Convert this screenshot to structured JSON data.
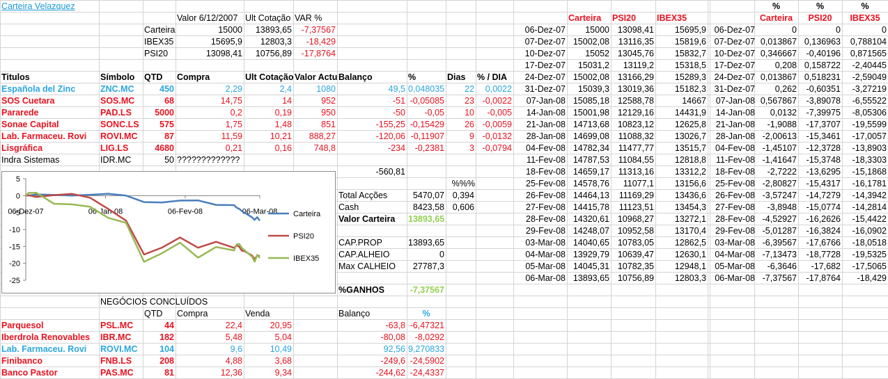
{
  "colors": {
    "red": "#e8121f",
    "blue": "#2aa6de",
    "green": "#92d050",
    "gridline": "#d4d4d4"
  },
  "title": "Carteira Velazquez",
  "summary": {
    "headers": {
      "valor": "Valor 6/12/2007",
      "ult": "Ult Cotação",
      "var": "VAR %"
    },
    "rows": [
      {
        "name": "Carteira",
        "valor": "15000",
        "ult": "13893,65",
        "var": "-7,37567"
      },
      {
        "name": "IBEX35",
        "valor": "15695,9",
        "ult": "12803,3",
        "var": "-18,429"
      },
      {
        "name": "PSI20",
        "valor": "13098,41",
        "ult": "10756,89",
        "var": "-17,8764"
      }
    ]
  },
  "holdings": {
    "headers": [
      "Titulos",
      "Símbolo",
      "QTD",
      "Compra",
      "Ult Cotação",
      "Valor Actual",
      "Balanço",
      "%",
      "Dias",
      "% / DIA"
    ],
    "rows": [
      {
        "color": "blue",
        "cells": [
          "Española del Zinc",
          "ZNC.MC",
          "450",
          "2,29",
          "2,4",
          "1080",
          "49,5",
          "0,048035",
          "22",
          "0,0022"
        ]
      },
      {
        "color": "red",
        "cells": [
          "SOS Cuetara",
          "SOS.MC",
          "68",
          "14,75",
          "14",
          "952",
          "-51",
          "-0,05085",
          "23",
          "-0,0022"
        ]
      },
      {
        "color": "red",
        "cells": [
          "Pararede",
          "PAD.LS",
          "5000",
          "0,2",
          "0,19",
          "950",
          "-50",
          "-0,05",
          "10",
          "-0,005"
        ]
      },
      {
        "color": "red",
        "cells": [
          "Sonae Capital",
          "SONC.LS",
          "575",
          "1,75",
          "1,48",
          "851",
          "-155,25",
          "-0,15429",
          "26",
          "-0,0059"
        ]
      },
      {
        "color": "red",
        "cells": [
          "Lab. Farmaceu. Rovi",
          "ROVI.MC",
          "87",
          "11,59",
          "10,21",
          "888,27",
          "-120,06",
          "-0,11907",
          "9",
          "-0,0132"
        ]
      },
      {
        "color": "red",
        "cells": [
          "Lisgráfica",
          "LIG.LS",
          "4680",
          "0,21",
          "0,16",
          "748,8",
          "-234",
          "-0,2381",
          "3",
          "-0,0794"
        ]
      }
    ],
    "indra": {
      "name": "Indra Sistemas",
      "symbol": "IDR.MC",
      "qty": "50",
      "compra": "?????????????"
    }
  },
  "totals": {
    "balance_sum": "-560,81",
    "pct_header": "%%%",
    "total_accoes_label": "Total Acções",
    "total_accoes": "5470,07",
    "total_accoes_pct": "0,394",
    "cash_label": "Cash",
    "cash": "8423,58",
    "cash_pct": "0,606",
    "valor_label": "Valor Carteira",
    "valor": "13893,65",
    "cap_prop_label": "CAP.PROP",
    "cap_prop": "13893,65",
    "cap_alheio_label": "CAP.ALHEIO",
    "cap_alheio": "0",
    "max_calheio_label": "Max CALHEIO",
    "max_calheio": "27787,3",
    "ganhos_label": "%GANHOS",
    "ganhos": "-7,37567"
  },
  "closed": {
    "title": "NEGÓCIOS CONCLUÍDOS",
    "headers": {
      "qtd": "QTD",
      "compra": "Compra",
      "venda": "Venda",
      "balanco": "Balanço",
      "pct": "%"
    },
    "rows": [
      {
        "color": "red",
        "cells": [
          "Parquesol",
          "PSL.MC",
          "44",
          "22,4",
          "20,95",
          "-63,8",
          "-6,47321"
        ]
      },
      {
        "color": "red",
        "cells": [
          "Iberdrola Renovables",
          "IBR.MC",
          "182",
          "5,48",
          "5,04",
          "-80,08",
          "-8,0292"
        ]
      },
      {
        "color": "blue",
        "cells": [
          "Lab. Farmaceu. Rovi",
          "ROVI.MC",
          "104",
          "9,6",
          "10,49",
          "92,56",
          "9,270833"
        ]
      },
      {
        "color": "red",
        "cells": [
          "Finibanco",
          "FNB.LS",
          "208",
          "4,88",
          "3,68",
          "-249,6",
          "-24,5902"
        ]
      },
      {
        "color": "red",
        "cells": [
          "Banco Pastor",
          "PAS.MC",
          "81",
          "12,36",
          "9,34",
          "-244,62",
          "-24,4337"
        ]
      }
    ]
  },
  "history": {
    "headers": [
      "Carteira",
      "PSI20",
      "IBEX35"
    ],
    "rows": [
      [
        "06-Dez-07",
        "15000",
        "13098,41",
        "15695,9"
      ],
      [
        "07-Dez-07",
        "15002,08",
        "13116,35",
        "15819,6"
      ],
      [
        "10-Dez-07",
        "15052",
        "13045,76",
        "15832,7"
      ],
      [
        "17-Dez-07",
        "15031,2",
        "13119,2",
        "15318,5"
      ],
      [
        "24-Dez-07",
        "15002,08",
        "13166,29",
        "15289,3"
      ],
      [
        "31-Dez-07",
        "15039,3",
        "13019,36",
        "15182,3"
      ],
      [
        "07-Jan-08",
        "15085,18",
        "12588,78",
        "14667"
      ],
      [
        "14-Jan-08",
        "15001,98",
        "12129,16",
        "14431,9"
      ],
      [
        "21-Jan-08",
        "14713,68",
        "10823,12",
        "12625,8"
      ],
      [
        "28-Jan-08",
        "14699,08",
        "11088,32",
        "13026,7"
      ],
      [
        "04-Fev-08",
        "14782,34",
        "11477,77",
        "13515,7"
      ],
      [
        "11-Fev-08",
        "14787,53",
        "11084,55",
        "12818,8"
      ],
      [
        "18-Fev-08",
        "14659,17",
        "11313,16",
        "13312,2"
      ],
      [
        "25-Fev-08",
        "14578,76",
        "11077,1",
        "13156,6"
      ],
      [
        "26-Fev-08",
        "14464,13",
        "11169,29",
        "13436,6"
      ],
      [
        "27-Fev-08",
        "14415,78",
        "11123,51",
        "13454,3"
      ],
      [
        "28-Fev-08",
        "14320,61",
        "10968,27",
        "13272,1"
      ],
      [
        "29-Fev-08",
        "14248,07",
        "10952,58",
        "13170,4"
      ],
      [
        "03-Mar-08",
        "14040,65",
        "10783,05",
        "12862,5"
      ],
      [
        "04-Mar-08",
        "13929,79",
        "10639,47",
        "12630,1"
      ],
      [
        "05-Mar-08",
        "14045,31",
        "10782,35",
        "12948,1"
      ],
      [
        "06-Mar-08",
        "13893,65",
        "10756,89",
        "12803,3"
      ]
    ]
  },
  "pct_history": {
    "headers_top": [
      "%",
      "%",
      "%"
    ],
    "headers": [
      "Carteira",
      "PSI20",
      "IBEX35"
    ],
    "rows": [
      [
        "06-Dez-07",
        "0",
        "0",
        "0"
      ],
      [
        "07-Dez-07",
        "0,013867",
        "0,136963",
        "0,788104"
      ],
      [
        "10-Dez-07",
        "0,346667",
        "-0,40196",
        "0,871565"
      ],
      [
        "17-Dez-07",
        "0,208",
        "0,158722",
        "-2,40445"
      ],
      [
        "24-Dez-07",
        "0,013867",
        "0,518231",
        "-2,59049"
      ],
      [
        "31-Dez-07",
        "0,262",
        "-0,60351",
        "-3,27219"
      ],
      [
        "07-Jan-08",
        "0,567867",
        "-3,89078",
        "-6,55522"
      ],
      [
        "14-Jan-08",
        "0,0132",
        "-7,39975",
        "-8,05306"
      ],
      [
        "21-Jan-08",
        "-1,9088",
        "-17,3707",
        "-19,5599"
      ],
      [
        "28-Jan-08",
        "-2,00613",
        "-15,3461",
        "-17,0057"
      ],
      [
        "04-Fev-08",
        "-1,45107",
        "-12,3728",
        "-13,8903"
      ],
      [
        "11-Fev-08",
        "-1,41647",
        "-15,3748",
        "-18,3303"
      ],
      [
        "18-Fev-08",
        "-2,7222",
        "-13,6295",
        "-15,1868"
      ],
      [
        "25-Fev-08",
        "-2,80827",
        "-15,4317",
        "-16,1781"
      ],
      [
        "26-Fev-08",
        "-3,57247",
        "-14,7279",
        "-14,3942"
      ],
      [
        "27-Fev-08",
        "-3,8948",
        "-15,0774",
        "-14,2814"
      ],
      [
        "28-Fev-08",
        "-4,52927",
        "-16,2626",
        "-15,4422"
      ],
      [
        "29-Fev-08",
        "-5,01287",
        "-16,3824",
        "-16,0902"
      ],
      [
        "03-Mar-08",
        "-6,39567",
        "-17,6766",
        "-18,0518"
      ],
      [
        "04-Mar-08",
        "-7,13473",
        "-18,7728",
        "-19,5325"
      ],
      [
        "05-Mar-08",
        "-6,3646",
        "-17,682",
        "-17,5065"
      ],
      [
        "06-Mar-08",
        "-7,37567",
        "-17,8764",
        "-18,429"
      ]
    ]
  },
  "chart_data": {
    "type": "line",
    "x_ticks": [
      "06-Dez-07",
      "06-Jan-08",
      "06-Fev-08",
      "06-Mar-08"
    ],
    "y_ticks": [
      "5",
      "0",
      "-5",
      "-10",
      "-15",
      "-20",
      "-25"
    ],
    "ylim": [
      -25,
      5
    ],
    "legend_position": "right",
    "series": [
      {
        "name": "Carteira",
        "color": "#4a7ebb",
        "points": [
          [
            0,
            0
          ],
          [
            1,
            0.0139
          ],
          [
            4,
            0.3467
          ],
          [
            11,
            0.208
          ],
          [
            18,
            0.0139
          ],
          [
            25,
            0.262
          ],
          [
            32,
            0.5679
          ],
          [
            39,
            0.0132
          ],
          [
            46,
            -1.9088
          ],
          [
            53,
            -2.0061
          ],
          [
            60,
            -1.4511
          ],
          [
            67,
            -1.4165
          ],
          [
            74,
            -2.7222
          ],
          [
            81,
            -2.8083
          ],
          [
            82,
            -3.5725
          ],
          [
            83,
            -3.8948
          ],
          [
            84,
            -4.5293
          ],
          [
            85,
            -5.0129
          ],
          [
            88,
            -6.3957
          ],
          [
            89,
            -7.1347
          ],
          [
            90,
            -6.3646
          ],
          [
            91,
            -7.3757
          ]
        ]
      },
      {
        "name": "PSI20",
        "color": "#be4b48",
        "points": [
          [
            0,
            0
          ],
          [
            1,
            0.137
          ],
          [
            4,
            -0.402
          ],
          [
            11,
            0.1587
          ],
          [
            18,
            0.5182
          ],
          [
            25,
            -0.6035
          ],
          [
            32,
            -3.8908
          ],
          [
            39,
            -7.3998
          ],
          [
            46,
            -17.3707
          ],
          [
            53,
            -15.3461
          ],
          [
            60,
            -12.3728
          ],
          [
            67,
            -15.3748
          ],
          [
            74,
            -13.6295
          ],
          [
            81,
            -15.4317
          ],
          [
            82,
            -14.7279
          ],
          [
            83,
            -15.0774
          ],
          [
            84,
            -16.2626
          ],
          [
            85,
            -16.3824
          ],
          [
            88,
            -17.6766
          ],
          [
            89,
            -18.7728
          ],
          [
            90,
            -17.682
          ],
          [
            91,
            -17.8764
          ]
        ]
      },
      {
        "name": "IBEX35",
        "color": "#98b954",
        "points": [
          [
            0,
            0
          ],
          [
            1,
            0.7881
          ],
          [
            4,
            0.8716
          ],
          [
            11,
            -2.4045
          ],
          [
            18,
            -2.5905
          ],
          [
            25,
            -3.2722
          ],
          [
            32,
            -6.5552
          ],
          [
            39,
            -8.0531
          ],
          [
            46,
            -19.5599
          ],
          [
            53,
            -17.0057
          ],
          [
            60,
            -13.8903
          ],
          [
            67,
            -18.3303
          ],
          [
            74,
            -15.1868
          ],
          [
            81,
            -16.1781
          ],
          [
            82,
            -14.3942
          ],
          [
            83,
            -14.2814
          ],
          [
            84,
            -15.4422
          ],
          [
            85,
            -16.0902
          ],
          [
            88,
            -18.0518
          ],
          [
            89,
            -19.5325
          ],
          [
            90,
            -17.5065
          ],
          [
            91,
            -18.429
          ]
        ]
      }
    ]
  }
}
